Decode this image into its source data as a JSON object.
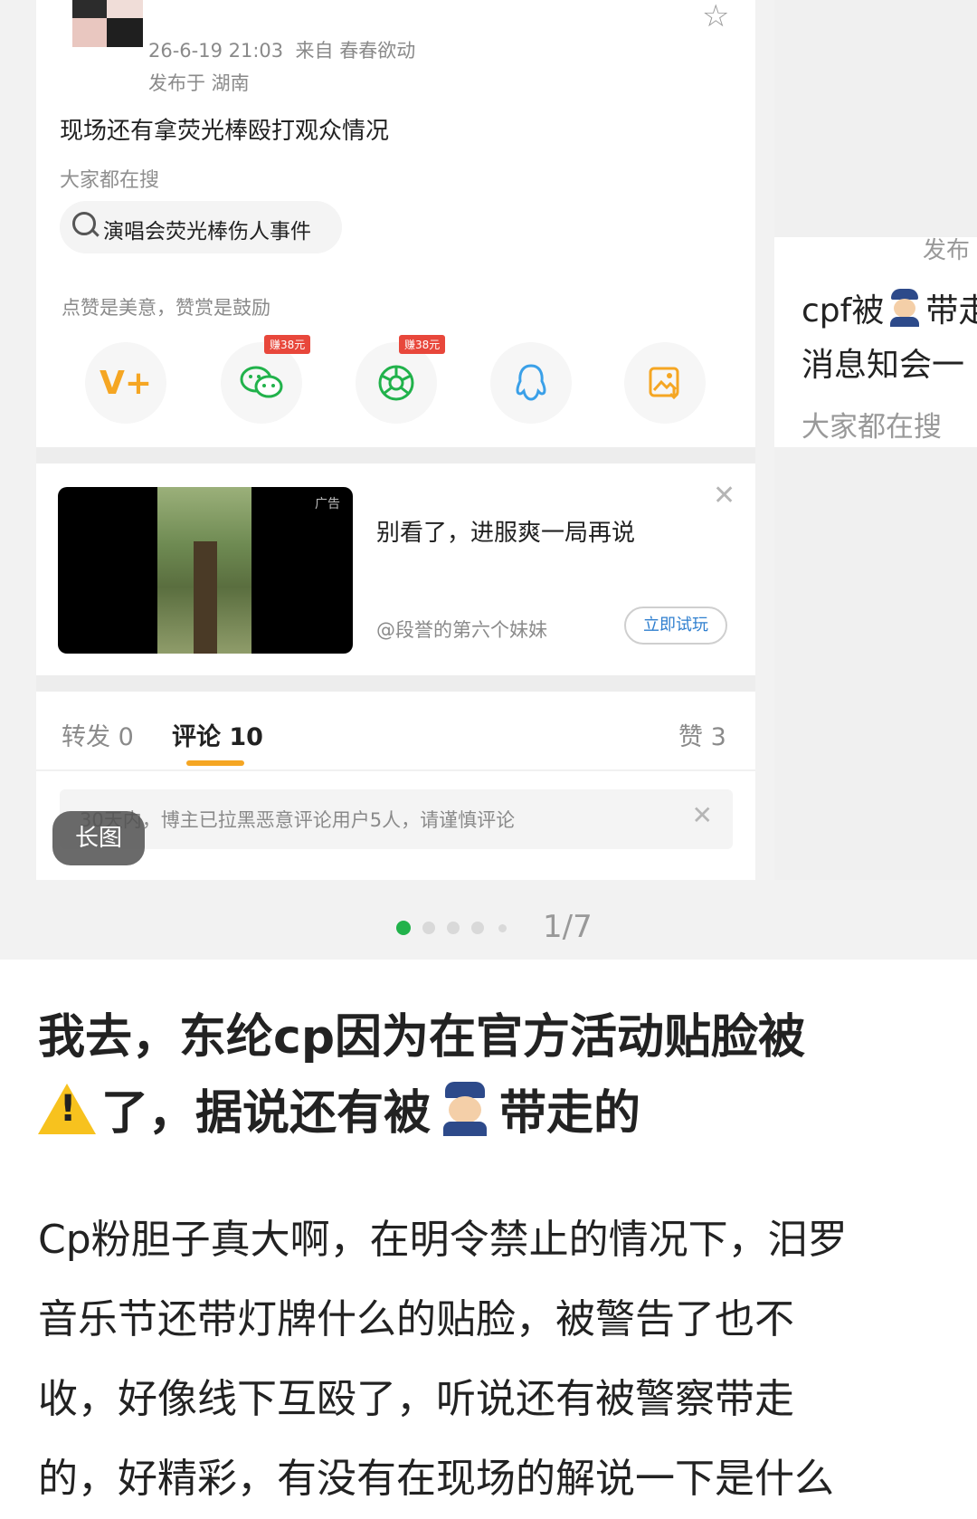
{
  "post": {
    "timestamp": "26-6-19 21:03",
    "from_label": "来自",
    "source": "春春欲动",
    "location": "发布于 湖南",
    "text": "现场还有拿荧光棒殴打观众情况",
    "search_label": "大家都在搜",
    "search_term": "演唱会荧光棒伤人事件",
    "encourage": "点赞是美意，赞赏是鼓励",
    "share_buttons": [
      {
        "name": "vplus",
        "icon": "vplus-icon",
        "color": "#f5a623",
        "badge": ""
      },
      {
        "name": "wechat",
        "icon": "wechat-icon",
        "color": "#21b24b",
        "badge": "赚38元"
      },
      {
        "name": "moments",
        "icon": "moments-icon",
        "color": "#21b24b",
        "badge": "赚38元"
      },
      {
        "name": "qq",
        "icon": "qq-icon",
        "color": "#3aa0e8",
        "badge": ""
      },
      {
        "name": "save-image",
        "icon": "save-image-icon",
        "color": "#f5a623",
        "badge": ""
      }
    ]
  },
  "ad": {
    "tag": "广告",
    "title": "别看了，进服爽一局再说",
    "author": "@段誉的第六个妹妹",
    "cta": "立即试玩"
  },
  "tabs": {
    "repost": "转发 0",
    "comments": "评论 10",
    "likes": "赞 3"
  },
  "notice": {
    "text": "30天内，博主已拉黑恶意评论用户5人，请谨慎评论"
  },
  "long_image_label": "长图",
  "side_card": {
    "cut_text": "发布",
    "line1_a": "cpf被",
    "line1_b": "带走",
    "line2": "消息知会一",
    "label": "大家都在搜"
  },
  "pager": {
    "counter": "1/7",
    "active_color": "#21b24b"
  },
  "article": {
    "title_line1": "我去，东纶cp因为在官方活动贴脸被",
    "title_line2_a": "了，据说还有被",
    "title_line2_b": "带走的",
    "body_lines": [
      "Cp粉胆子真大啊，在明令禁止的情况下，汨罗",
      "音乐节还带灯牌什么的贴脸，被警告了也不",
      "收，好像线下互殴了，听说还有被警察带走",
      "的，好精彩，有没有在现场的解说一下是什么"
    ]
  }
}
